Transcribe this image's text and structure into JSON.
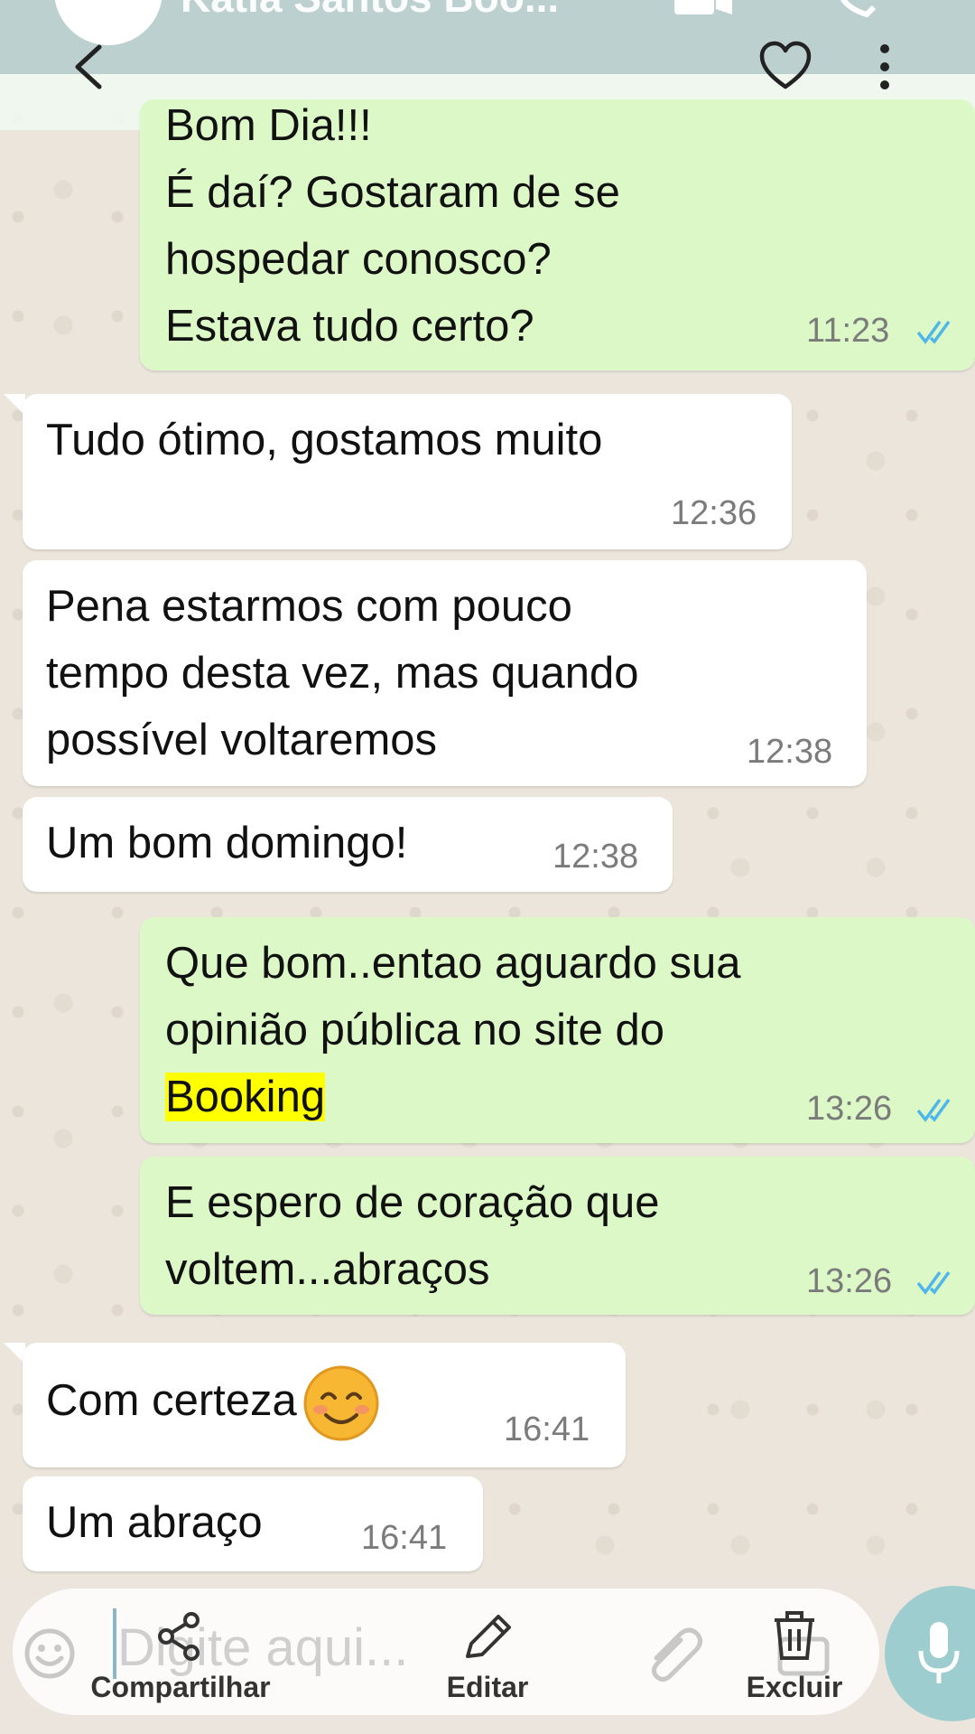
{
  "header": {
    "contact_name_partial": "Katia Santos Boo..."
  },
  "messages": [
    {
      "direction": "out",
      "text": "Bom Dia!!!\nÉ daí? Gostaram de se\nhospedar conosco?\nEstava tudo certo?",
      "time": "11:23",
      "status": "read"
    },
    {
      "direction": "in",
      "text": "Tudo ótimo, gostamos muito",
      "time": "12:36"
    },
    {
      "direction": "in",
      "text": "Pena estarmos com pouco\ntempo desta vez, mas quando\npossível voltaremos",
      "time": "12:38"
    },
    {
      "direction": "in",
      "text": "Um bom domingo!",
      "time": "12:38"
    },
    {
      "direction": "out",
      "text_before_highlight": "Que bom..entao aguardo sua\nopinião pública no site do\n",
      "highlight": "Booking",
      "time": "13:26",
      "status": "read"
    },
    {
      "direction": "out",
      "text": "E  espero de coração que\nvoltem...abraços",
      "time": "13:26",
      "status": "read"
    },
    {
      "direction": "in",
      "text": "Com certeza",
      "emoji": "smiling-face",
      "time": "16:41"
    },
    {
      "direction": "in",
      "text": "Um abraço",
      "time": "16:41"
    }
  ],
  "composer": {
    "placeholder": "Digite aqui..."
  },
  "actions": {
    "share": "Compartilhar",
    "edit": "Editar",
    "delete": "Excluir"
  },
  "colors": {
    "outgoing_bubble": "#dcf8c6",
    "incoming_bubble": "#ffffff",
    "read_check": "#4fb6ec",
    "highlight": "#ffff00",
    "header": "#bcd1cf"
  }
}
